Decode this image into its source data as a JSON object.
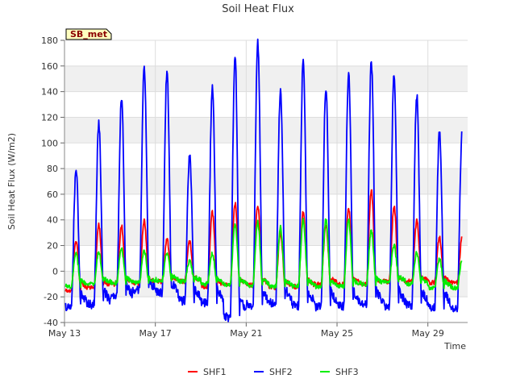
{
  "chart_data": {
    "type": "line",
    "title": "Soil Heat Flux",
    "xlabel": "Time",
    "ylabel": "Soil Heat Flux (W/m2)",
    "site_badge": "SB_met",
    "ylim": [
      -40,
      180
    ],
    "yticks": [
      -40,
      -20,
      0,
      20,
      40,
      60,
      80,
      100,
      120,
      140,
      160,
      180
    ],
    "xlim": [
      "2024-05-13",
      "2024-05-30 18:00"
    ],
    "xticks": [
      {
        "label": "May 13",
        "date": "2024-05-13"
      },
      {
        "label": "May 17",
        "date": "2024-05-17"
      },
      {
        "label": "May 21",
        "date": "2024-05-21"
      },
      {
        "label": "May 25",
        "date": "2024-05-25"
      },
      {
        "label": "May 29",
        "date": "2024-05-29"
      }
    ],
    "grid": true,
    "banded_background": true,
    "legend_position": "bottom-center",
    "days": [
      "May 13",
      "May 14",
      "May 15",
      "May 16",
      "May 17",
      "May 18",
      "May 19",
      "May 20",
      "May 21",
      "May 22",
      "May 23",
      "May 24",
      "May 25",
      "May 26",
      "May 27",
      "May 28",
      "May 29",
      "May 30"
    ],
    "series": [
      {
        "name": "SHF1",
        "color": "#ff0000",
        "daily_peak": [
          23,
          36,
          35,
          39,
          25,
          23,
          46,
          53,
          51,
          30,
          47,
          35,
          49,
          63,
          50,
          39,
          26
        ],
        "daily_min": [
          -15,
          -13,
          -10,
          -10,
          -8,
          -8,
          -12,
          -11,
          -11,
          -13,
          -12,
          -10,
          -10,
          -10,
          -8,
          -8,
          -9,
          -8
        ]
      },
      {
        "name": "SHF2",
        "color": "#0000ff",
        "daily_peak": [
          78,
          115,
          135,
          160,
          156,
          91,
          143,
          168,
          178,
          142,
          164,
          143,
          155,
          164,
          154,
          137,
          108
        ],
        "daily_min": [
          -28,
          -26,
          -20,
          -15,
          -17,
          -23,
          -25,
          -36,
          -27,
          -25,
          -27,
          -28,
          -27,
          -26,
          -27,
          -27,
          -29,
          -25
        ]
      },
      {
        "name": "SHF3",
        "color": "#00ee00",
        "daily_peak": [
          13,
          15,
          17,
          16,
          14,
          8,
          14,
          37,
          38,
          34,
          40,
          40,
          40,
          31,
          20,
          15,
          10
        ],
        "daily_min": [
          -12,
          -10,
          -9,
          -9,
          -7,
          -8,
          -10,
          -11,
          -11,
          -12,
          -12,
          -12,
          -12,
          -10,
          -8,
          -10,
          -13,
          -13
        ]
      }
    ]
  }
}
